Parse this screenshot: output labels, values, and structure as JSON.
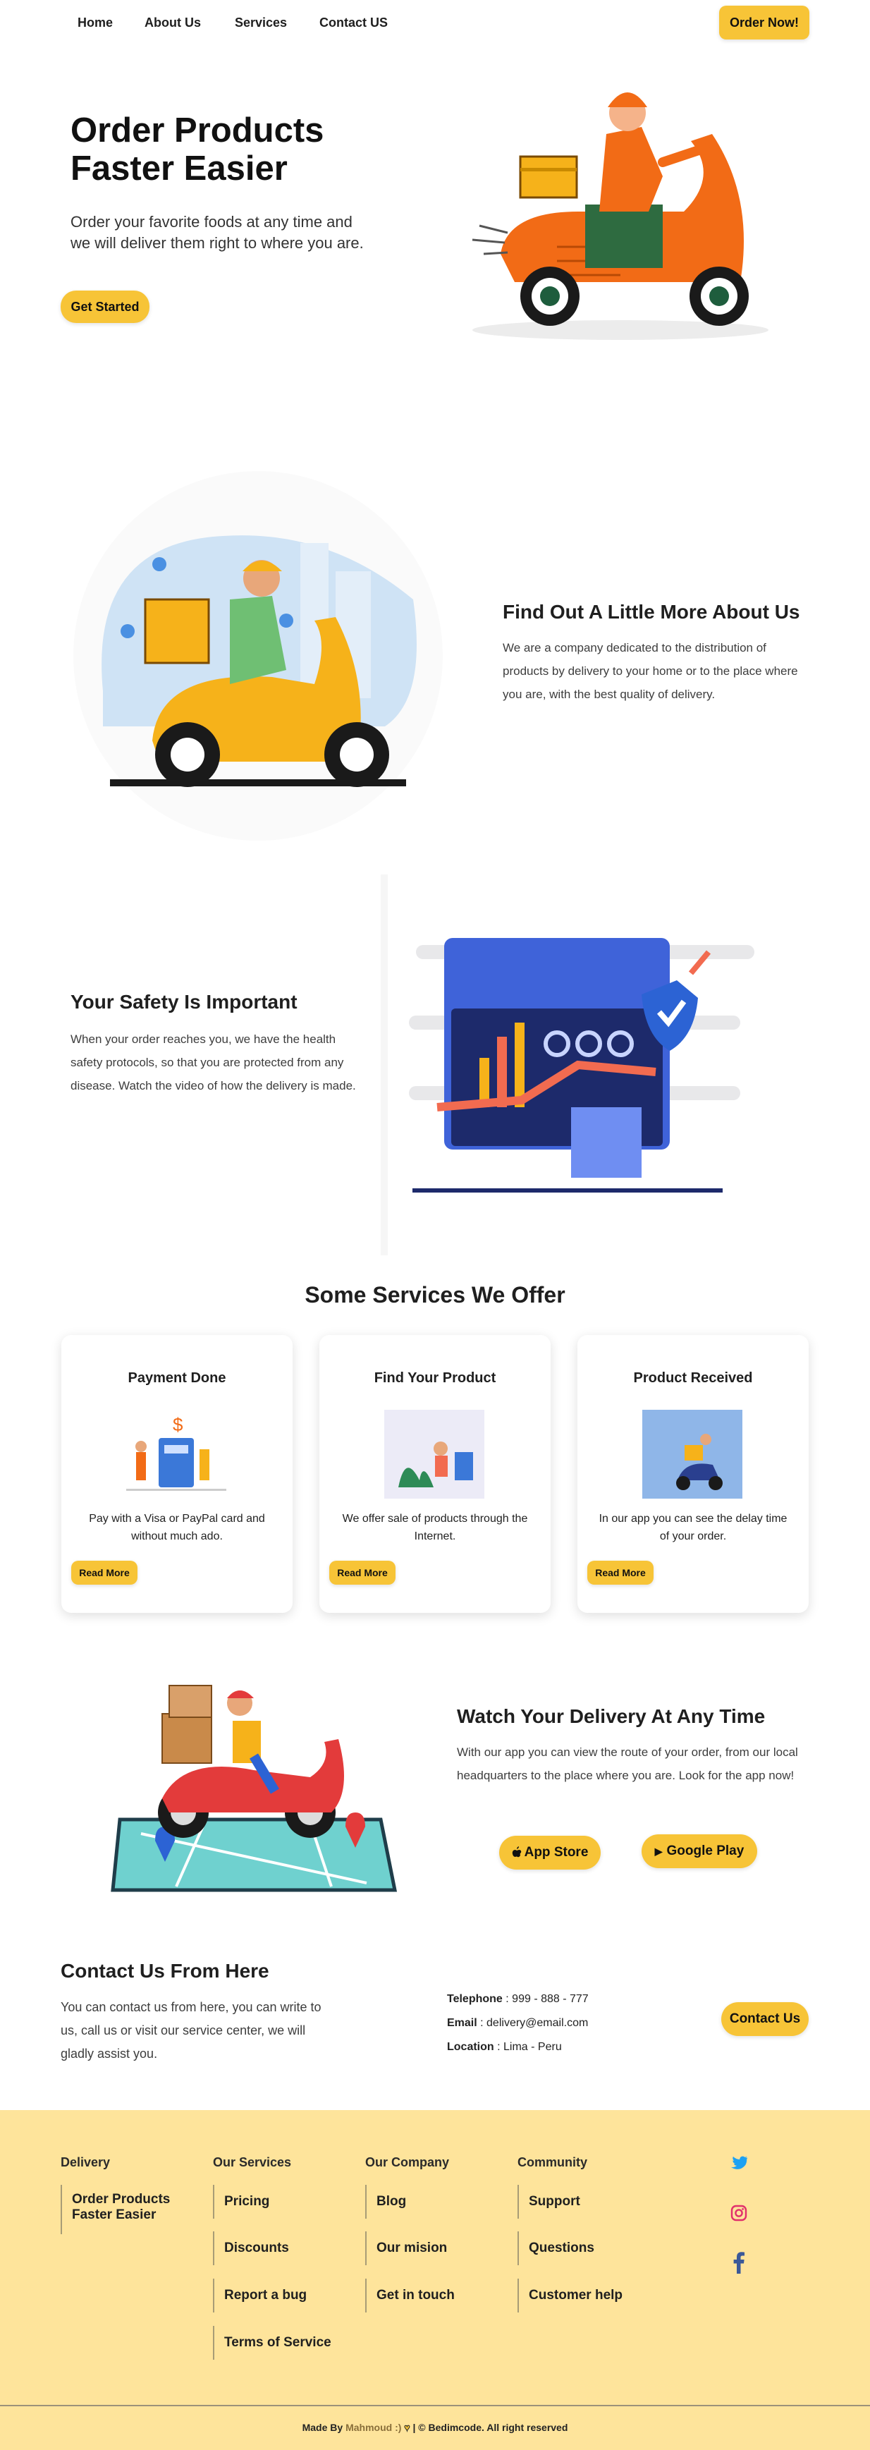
{
  "nav": {
    "links": [
      "Home",
      "About Us",
      "Services",
      "Contact US"
    ],
    "order_button": "Order Now!"
  },
  "hero": {
    "title_line1": "Order Products",
    "title_line2": "Faster Easier",
    "text": "Order your favorite foods at any time and we will deliver them right to where you are.",
    "button": "Get Started"
  },
  "about": {
    "title": "Find Out A Little More About Us",
    "text": "We are a company dedicated to the distribution of products by delivery to your home or to the place where you are, with the best quality of delivery."
  },
  "safety": {
    "title": "Your Safety Is Important",
    "text": "When your order reaches you, we have the health safety protocols, so that you are protected from any disease. Watch the video of how the delivery is made."
  },
  "services": {
    "title": "Some Services We Offer",
    "cards": [
      {
        "title": "Payment Done",
        "text": "Pay with a Visa or PayPal card and without much ado.",
        "button": "Read More"
      },
      {
        "title": "Find Your Product",
        "text": "We offer sale of products through the Internet.",
        "button": "Read More"
      },
      {
        "title": "Product Received",
        "text": "In our app you can see the delay time of your order.",
        "button": "Read More"
      }
    ]
  },
  "app": {
    "title": "Watch Your Delivery At Any Time",
    "text": "With our app you can view the route of your order, from our local headquarters to the place where you are. Look for the app now!",
    "app_store": "App Store",
    "google_play": "Google Play"
  },
  "contact": {
    "title": "Contact Us From Here",
    "text": "You can contact us from here, you can write to us, call us or visit our service center, we will gladly assist you.",
    "telephone_label": "Telephone",
    "telephone": "999 - 888 - 777",
    "email_label": "Email",
    "email": "delivery@email.com",
    "location_label": "Location",
    "location": "Lima - Peru",
    "button": "Contact Us"
  },
  "footer": {
    "delivery": {
      "title": "Delivery",
      "items": [
        "Order Products Faster Easier"
      ]
    },
    "services": {
      "title": "Our Services",
      "items": [
        "Pricing",
        "Discounts",
        "Report a bug",
        "Terms of Service"
      ]
    },
    "company": {
      "title": "Our Company",
      "items": [
        "Blog",
        "Our mision",
        "Get in touch"
      ]
    },
    "community": {
      "title": "Community",
      "items": [
        "Support",
        "Questions",
        "Customer help"
      ]
    },
    "social": [
      "twitter-icon",
      "instagram-icon",
      "facebook-icon"
    ],
    "made_by": "Made By",
    "author": "Mahmoud :)",
    "rights": "| © Bedimcode. All right reserved"
  },
  "colors": {
    "accent": "#f7c437",
    "footer_bg": "#fee49b",
    "twitter": "#1da1f2",
    "instagram": "#e1306c",
    "facebook": "#3b5998"
  }
}
